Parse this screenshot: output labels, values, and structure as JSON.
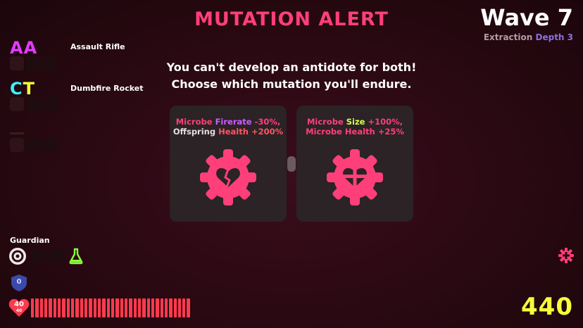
{
  "header": {
    "title": "MUTATION ALERT",
    "wave": "Wave 7",
    "mode": "Extraction",
    "depth": "Depth 3"
  },
  "weapons": [
    {
      "code": "AA",
      "name": "Assault Rifle",
      "code_color": "#e03cff"
    },
    {
      "code": "CT",
      "name": "Dumbfire Rocket",
      "code_color": "gradient-cyan-yellow"
    }
  ],
  "prompt": {
    "line1": "You can't develop an antidote for both!",
    "line2": "Choose which mutation you'll endure."
  },
  "options": [
    {
      "icon": "broken-heart-gear-icon",
      "line1_a": "Microbe",
      "line1_b": "Firerate",
      "line1_c": "-30%,",
      "line2_a": "Offspring",
      "line2_b": "Health",
      "line2_c": "+200%"
    },
    {
      "icon": "cross-heart-gear-icon",
      "line1_a": "Microbe",
      "line1_b": "Size",
      "line1_c": "+100%,",
      "line2_a": "Microbe Health",
      "line2_c": "+25%"
    }
  ],
  "player": {
    "class": "Guardian",
    "health": "40",
    "health_max": "40",
    "shield": "0",
    "health_fraction": 1.0
  },
  "score": "440",
  "colors": {
    "accent": "#ff3f7a",
    "score": "#f4ff3a",
    "health": "#ff3a4d",
    "depth": "#8b6fdf"
  }
}
